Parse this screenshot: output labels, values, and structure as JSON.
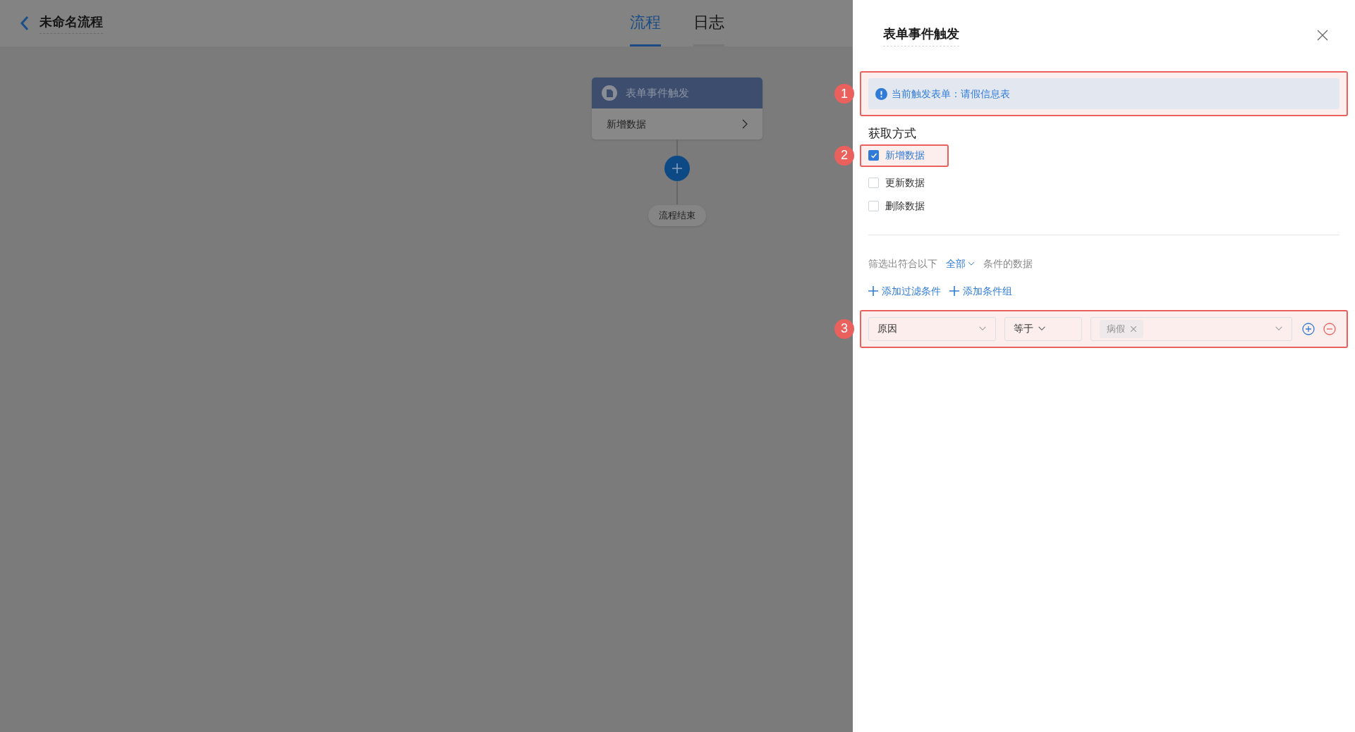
{
  "header": {
    "title": "未命名流程"
  },
  "tabs": [
    {
      "label": "流程",
      "selected": true
    },
    {
      "label": "日志",
      "selected": false
    }
  ],
  "flow": {
    "trigger": {
      "title": "表单事件触发",
      "detail": "新增数据"
    },
    "end": "流程结束"
  },
  "panel": {
    "title": "表单事件触发",
    "info": "当前触发表单：请假信息表",
    "method_label": "获取方式",
    "methods": [
      {
        "label": "新增数据",
        "checked": true
      },
      {
        "label": "更新数据",
        "checked": false
      },
      {
        "label": "删除数据",
        "checked": false
      }
    ],
    "filter": {
      "prefix": "筛选出符合以下",
      "mode": "全部",
      "suffix": "条件的数据",
      "actions": [
        "添加过滤条件",
        "添加条件组"
      ],
      "condition": {
        "field": "原因",
        "operator": "等于",
        "values": [
          "病假"
        ]
      }
    }
  },
  "annotations": [
    {
      "number": "1"
    },
    {
      "number": "2"
    },
    {
      "number": "3"
    }
  ]
}
